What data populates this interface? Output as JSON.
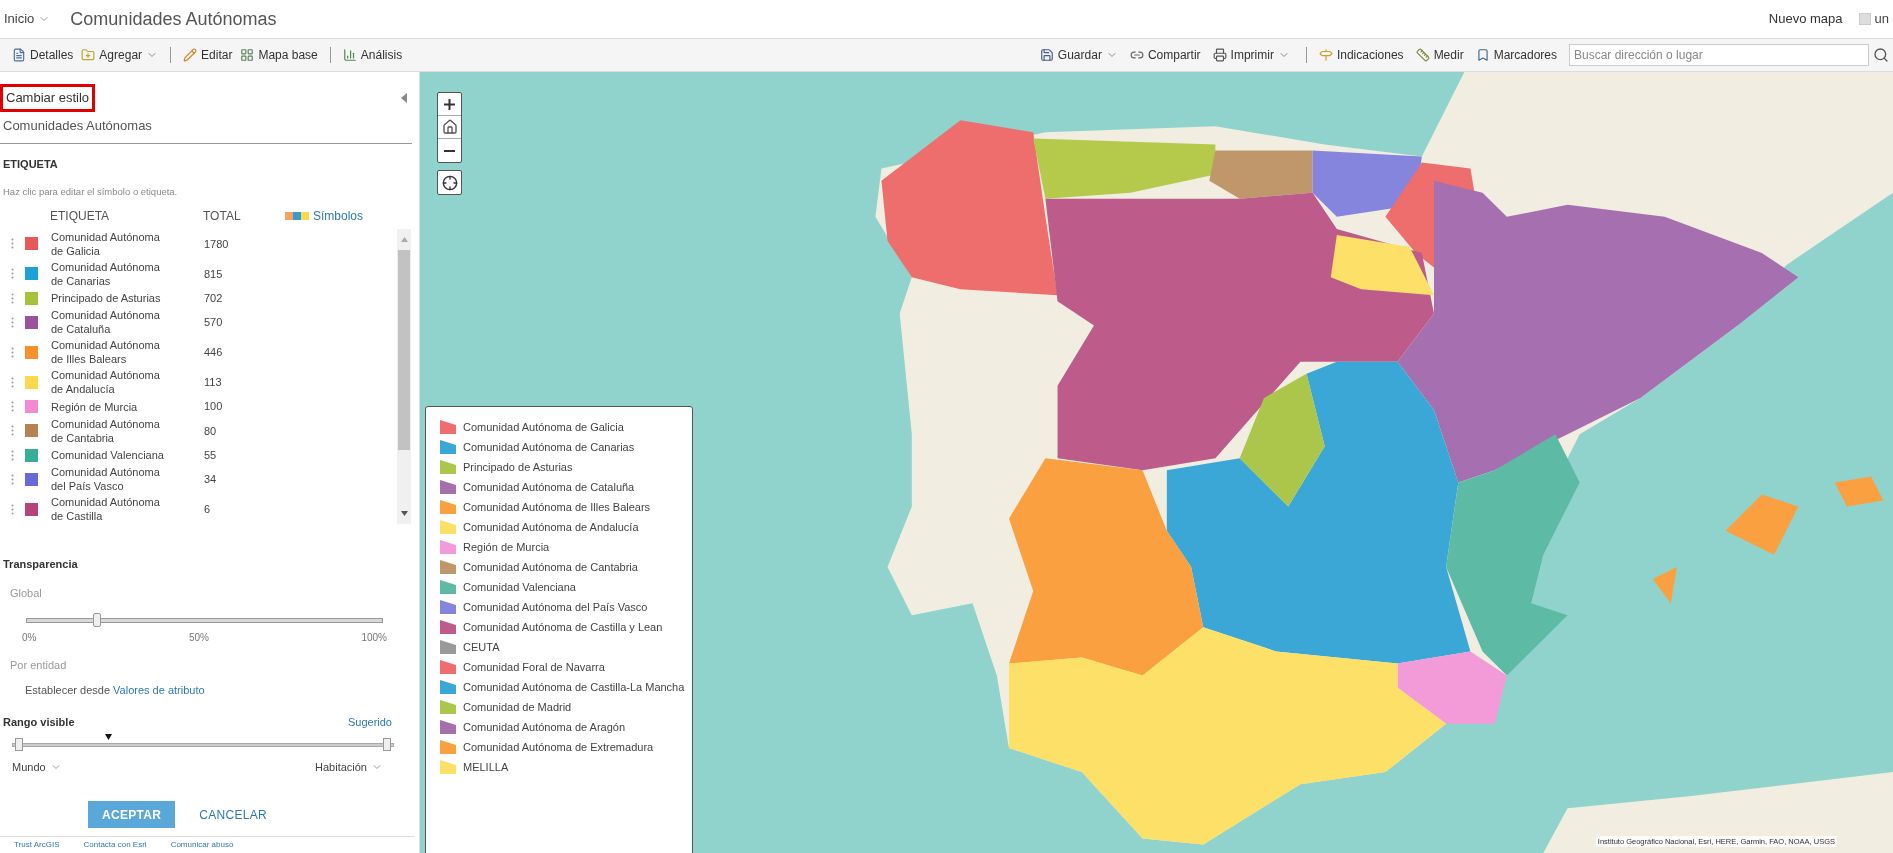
{
  "header": {
    "home_menu": "Inicio",
    "title": "Comunidades Autónomas",
    "new_map": "Nuevo mapa",
    "user": "un"
  },
  "toolbar_left": [
    {
      "label": "Detalles",
      "dropdown": false,
      "divider_before": false
    },
    {
      "label": "Agregar",
      "dropdown": true,
      "divider_before": false
    },
    {
      "label": "Editar",
      "dropdown": false,
      "divider_before": true
    },
    {
      "label": "Mapa base",
      "dropdown": false,
      "divider_before": false
    },
    {
      "label": "Análisis",
      "dropdown": false,
      "divider_before": true
    }
  ],
  "toolbar_right": [
    {
      "label": "Guardar",
      "dropdown": true,
      "divider_before": false
    },
    {
      "label": "Compartir",
      "dropdown": false,
      "divider_before": false
    },
    {
      "label": "Imprimir",
      "dropdown": true,
      "divider_before": false
    },
    {
      "label": "Indicaciones",
      "dropdown": false,
      "divider_before": true
    },
    {
      "label": "Medir",
      "dropdown": false,
      "divider_before": false
    },
    {
      "label": "Marcadores",
      "dropdown": false,
      "divider_before": false
    }
  ],
  "search": {
    "placeholder": "Buscar dirección o lugar"
  },
  "panel": {
    "heading": "Cambiar estilo",
    "heading_highlighted": true,
    "layer": "Comunidades Autónomas",
    "section": "ETIQUETA",
    "hint": "Haz clic para editar el símbolo o etiqueta.",
    "columns": [
      "ETIQUETA",
      "TOTAL"
    ],
    "symbols_link": "Símbolos",
    "rows": [
      {
        "label": "Comunidad Autónoma de Galicia",
        "total": "1780",
        "color": "#e8575a"
      },
      {
        "label": "Comunidad Autónoma de Canarias",
        "total": "815",
        "color": "#1ba1d6"
      },
      {
        "label": "Principado de Asturias",
        "total": "702",
        "color": "#a6c13a"
      },
      {
        "label": "Comunidad Autónoma de Cataluña",
        "total": "570",
        "color": "#9b529c"
      },
      {
        "label": "Comunidad Autónoma de Illes Balears",
        "total": "446",
        "color": "#f7902d"
      },
      {
        "label": "Comunidad Autónoma de Andalucía",
        "total": "113",
        "color": "#fcd94a"
      },
      {
        "label": "Región de Murcia",
        "total": "100",
        "color": "#f28bd2"
      },
      {
        "label": "Comunidad Autónoma de Cantabria",
        "total": "80",
        "color": "#b5834f"
      },
      {
        "label": "Comunidad Valenciana",
        "total": "55",
        "color": "#3aae95"
      },
      {
        "label": "Comunidad Autónoma del País Vasco",
        "total": "34",
        "color": "#6a6ad6"
      },
      {
        "label": "Comunidad Autónoma de Castilla",
        "total": "6",
        "color": "#b54478"
      }
    ],
    "transparency": {
      "title": "Transparencia",
      "global_label": "Global",
      "level": 0.2,
      "ticks": [
        "0%",
        "50%",
        "100%"
      ],
      "per_feature_label": "Por entidad",
      "set_from": "Establecer desde",
      "attribute_link": "Valores de atributo"
    },
    "visible_range": {
      "title": "Rango visible",
      "suggested": "Sugerido",
      "level": 0.25,
      "min": "Mundo",
      "max": "Habitación"
    },
    "accept": "ACEPTAR",
    "cancel": "CANCELAR",
    "footer_links": [
      "Trust ArcGIS",
      "Contacta con Esri",
      "Comunicar abuso"
    ]
  },
  "legend": [
    {
      "label": "Comunidad Autónoma de Galicia",
      "color": "#ee6e6e"
    },
    {
      "label": "Comunidad Autónoma de Canarias",
      "color": "#3aa7d6"
    },
    {
      "label": "Principado de Asturias",
      "color": "#abc64a"
    },
    {
      "label": "Comunidad Autónoma de Cataluña",
      "color": "#a56fb0"
    },
    {
      "label": "Comunidad Autónoma de Illes Balears",
      "color": "#fba040"
    },
    {
      "label": "Comunidad Autónoma de Andalucía",
      "color": "#fde068"
    },
    {
      "label": "Región de Murcia",
      "color": "#f39bd8"
    },
    {
      "label": "Comunidad Autónoma de Cantabria",
      "color": "#c0976b"
    },
    {
      "label": "Comunidad Valenciana",
      "color": "#5dbba5"
    },
    {
      "label": "Comunidad Autónoma del País Vasco",
      "color": "#8585de"
    },
    {
      "label": "Comunidad Autónoma de Castilla y Lean",
      "color": "#bd5c8a"
    },
    {
      "label": "CEUTA",
      "color": "#999999"
    },
    {
      "label": "Comunidad Foral de Navarra",
      "color": "#ee6e6e"
    },
    {
      "label": "Comunidad Autónoma de Castilla-La Mancha",
      "color": "#3aa7d6"
    },
    {
      "label": "Comunidad de Madrid",
      "color": "#abc64a"
    },
    {
      "label": "Comunidad Autónoma de Aragón",
      "color": "#a56fb0"
    },
    {
      "label": "Comunidad Autónoma de Extremadura",
      "color": "#fba040"
    },
    {
      "label": "MELILLA",
      "color": "#fde068"
    }
  ],
  "attribution": "Instituto Geográfico Nacional, Esri, HERE, Garmin, FAO, NOAA, USGS"
}
